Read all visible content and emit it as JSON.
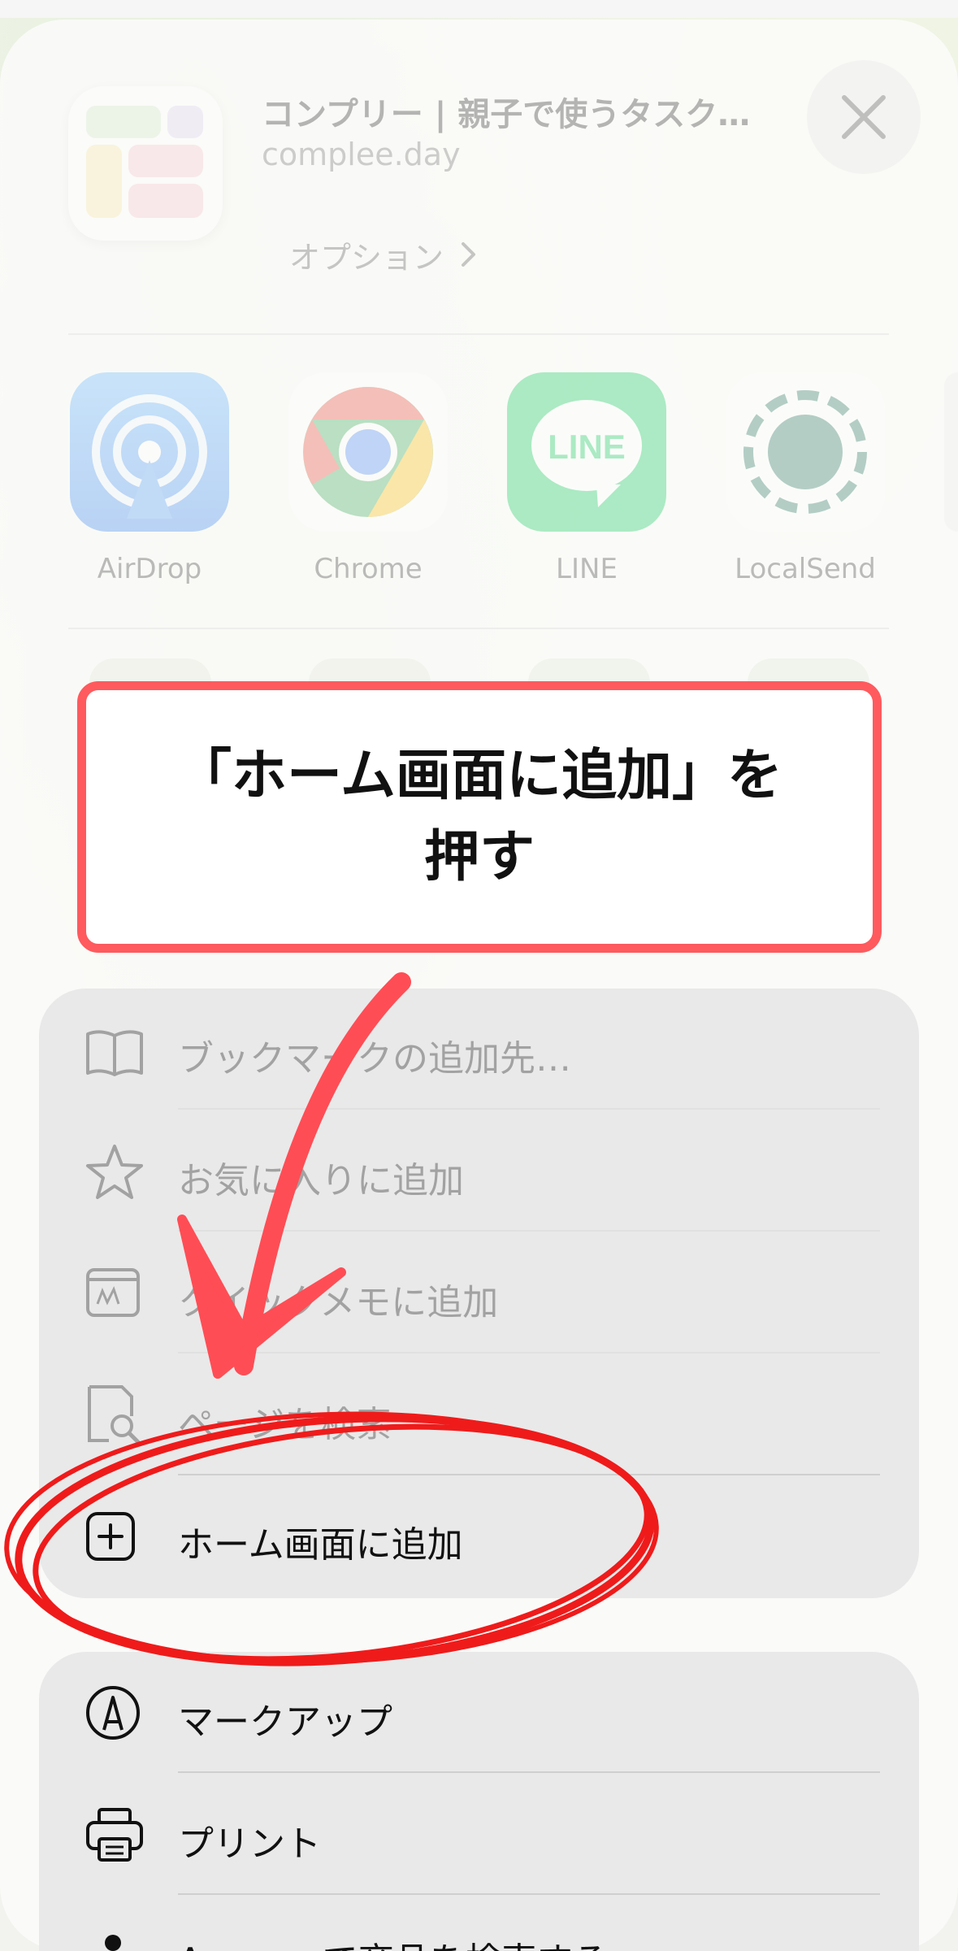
{
  "sheet_header": {
    "site_title": "コンプリー | 親子で使うタスク…",
    "site_url": "complee.day",
    "options_label": "オプション",
    "close_icon": "close-icon"
  },
  "share_apps": [
    {
      "label": "AirDrop",
      "icon": "airdrop-icon"
    },
    {
      "label": "Chrome",
      "icon": "chrome-icon"
    },
    {
      "label": "LINE",
      "icon": "line-icon",
      "icon_text": "LINE"
    },
    {
      "label": "LocalSend",
      "icon": "localsend-icon"
    }
  ],
  "actions_group_1": [
    {
      "label": "ブックマークの追加先…",
      "icon": "book-icon"
    },
    {
      "label": "お気に入りに追加",
      "icon": "star-icon"
    },
    {
      "label": "クイックメモに追加",
      "icon": "quick-note-icon"
    },
    {
      "label": "ページを検索",
      "icon": "find-in-page-icon"
    },
    {
      "label": "ホーム画面に追加",
      "icon": "add-square-icon"
    }
  ],
  "actions_group_2": [
    {
      "label": "マークアップ",
      "icon": "markup-icon"
    },
    {
      "label": "プリント",
      "icon": "printer-icon"
    },
    {
      "label": "Amazonで商品を検索する",
      "icon": "amazon-icon"
    }
  ],
  "annotation": {
    "callout_text": "「ホーム画面に追加」を押す",
    "accent_color": "#ff3b3b"
  }
}
